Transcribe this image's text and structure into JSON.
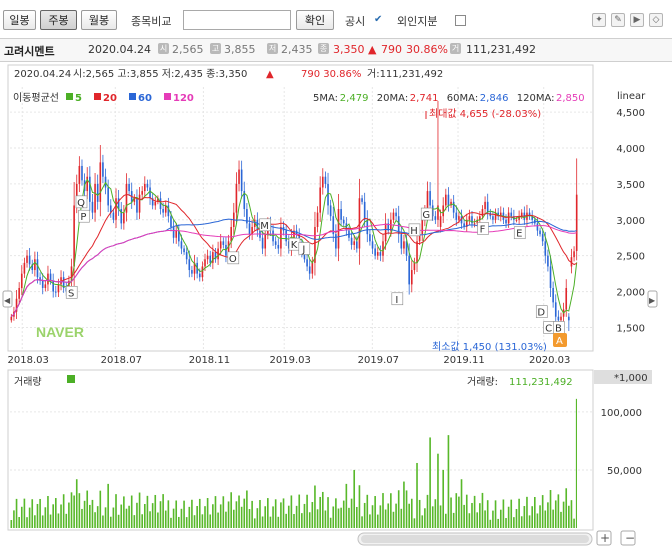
{
  "toolbar": {
    "day_label": "일봉",
    "week_label": "주봉",
    "month_label": "월봉",
    "compare_label": "종목비교",
    "compare_value": "",
    "confirm_label": "확인",
    "notice_label": "공시",
    "notice_checked": "✔",
    "foreign_label": "외인지분"
  },
  "info": {
    "name": "고려시멘트",
    "date": "2020.04.24",
    "open": "2,565",
    "high": "3,855",
    "low": "2,435",
    "close": "3,350",
    "change_arrow": "▲",
    "change": "790",
    "change_pct": "30.86%",
    "volume": "111,231,492",
    "icon_open": "시",
    "icon_high": "고",
    "icon_low": "저",
    "icon_close": "종",
    "icon_volume": "거"
  },
  "price_panel": {
    "header_date": "2020.04.24",
    "header_text": "시:2,565 고:3,855 저:2,435 종:3,350",
    "header_arrow": "▲",
    "header_change": "790  30.86%",
    "header_volume": "거:111,231,492",
    "ma_title": "이동평균선",
    "ma_legend": [
      {
        "label": "5",
        "color": "#4caf26"
      },
      {
        "label": "20",
        "color": "#e0262b"
      },
      {
        "label": "60",
        "color": "#2a66d6"
      },
      {
        "label": "120",
        "color": "#e53cb8"
      }
    ],
    "ma_values": [
      {
        "label": "5MA:",
        "value": "2,479",
        "color": "#4caf26"
      },
      {
        "label": "20MA:",
        "value": "2,741",
        "color": "#e0262b"
      },
      {
        "label": "60MA:",
        "value": "2,846",
        "color": "#2a66d6"
      },
      {
        "label": "120MA:",
        "value": "2,850",
        "color": "#e53cb8"
      }
    ],
    "scale_mode": "linear",
    "max_label": "최대값 4,655 (-28.03%)",
    "min_label": "최소값 1,450 (131.03%)",
    "watermark": "NAVER",
    "markers": [
      {
        "label": "Q",
        "x": 29,
        "y": 3250
      },
      {
        "label": "P",
        "x": 30,
        "y": 3050
      },
      {
        "label": "S",
        "x": 25,
        "y": 1990
      },
      {
        "label": "O",
        "x": 91,
        "y": 2470
      },
      {
        "label": "M",
        "x": 104,
        "y": 2930
      },
      {
        "label": "K",
        "x": 116,
        "y": 2660
      },
      {
        "label": "J",
        "x": 120,
        "y": 2600
      },
      {
        "label": "H",
        "x": 165,
        "y": 2860
      },
      {
        "label": "I",
        "x": 158,
        "y": 1900
      },
      {
        "label": "G",
        "x": 170,
        "y": 3080
      },
      {
        "label": "F",
        "x": 193,
        "y": 2880
      },
      {
        "label": "E",
        "x": 208,
        "y": 2820
      },
      {
        "label": "D",
        "x": 217,
        "y": 1720
      },
      {
        "label": "C",
        "x": 220,
        "y": 1500
      },
      {
        "label": "B",
        "x": 224,
        "y": 1500
      }
    ],
    "badge": "A"
  },
  "volume_panel": {
    "title": "거래량",
    "value_label": "거래량:",
    "value": "111,231,492",
    "unit": "*1,000"
  },
  "chart_data": {
    "type": "candlestick",
    "price_axis": {
      "ticks": [
        "4,500",
        "4,000",
        "3,500",
        "3,000",
        "2,500",
        "2,000",
        "1,500"
      ],
      "ylim": [
        1200,
        4850
      ]
    },
    "volume_axis": {
      "ticks": [
        "100,000",
        "50,000"
      ],
      "ylim": [
        0,
        118000
      ]
    },
    "x_ticks": [
      {
        "label": "2018.03",
        "x": 5
      },
      {
        "label": "2018.07",
        "x": 43
      },
      {
        "label": "2018.11",
        "x": 79
      },
      {
        "label": "2019.03",
        "x": 112
      },
      {
        "label": "2019.07",
        "x": 148
      },
      {
        "label": "2019.11",
        "x": 183
      },
      {
        "label": "2020.03",
        "x": 218
      }
    ],
    "x_range": [
      0,
      232
    ],
    "candles": [],
    "volume": []
  }
}
